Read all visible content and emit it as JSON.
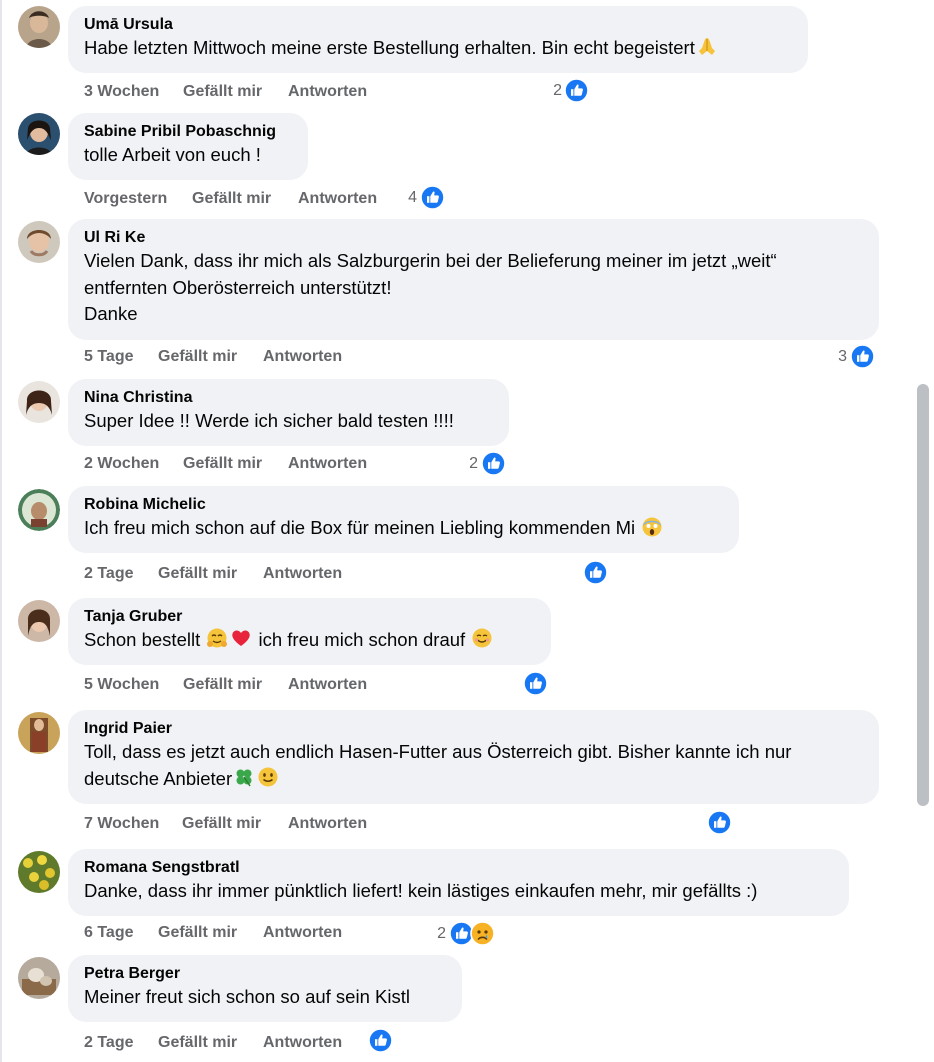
{
  "labels": {
    "like": "Gefällt mir",
    "reply": "Antworten"
  },
  "colors": {
    "like_blue": "#1877f2",
    "bubble": "#f0f2f5",
    "meta_grey": "#65676b",
    "heart": "#e8243c"
  },
  "comments": [
    {
      "author": "Umā Ursula",
      "text": "Habe letzten Mittwoch meine erste Bestellung erhalten. Bin echt begeistert",
      "emoji_after": [
        "folded-hands-emoji"
      ],
      "time": "3 Wochen",
      "reactions": "2",
      "reaction_icons": [
        "like-icon"
      ]
    },
    {
      "author": "Sabine Pribil Pobaschnig",
      "text": "tolle Arbeit von euch !",
      "time": "Vorgestern",
      "reactions": "4",
      "reaction_icons": [
        "like-icon"
      ]
    },
    {
      "author": "Ul Ri Ke",
      "text": "Vielen Dank, dass ihr mich als Salzburgerin bei der Belieferung meiner im jetzt „weit“ entfernten Oberösterreich unterstützt!\nDanke",
      "time": "5 Tage",
      "reactions": "3",
      "reaction_icons": [
        "like-icon"
      ]
    },
    {
      "author": "Nina Christina",
      "text": "Super Idee !! Werde ich sicher bald testen !!!!",
      "time": "2 Wochen",
      "reactions": "2",
      "reaction_icons": [
        "like-icon"
      ]
    },
    {
      "author": "Robina Michelic",
      "text": "Ich freu mich schon auf die Box für meinen Liebling kommenden Mi",
      "emoji_after": [
        "screaming-face-emoji"
      ],
      "time": "2 Tage",
      "reactions": "",
      "reaction_icons": [
        "like-icon"
      ]
    },
    {
      "author": "Tanja Gruber",
      "text_parts": [
        "Schon bestellt",
        "ich freu mich schon drauf"
      ],
      "emoji_mid": [
        "hugging-face-emoji",
        "red-heart-emoji"
      ],
      "emoji_after": [
        "smiling-face-emoji"
      ],
      "time": "5 Wochen",
      "reactions": "",
      "reaction_icons": [
        "like-icon"
      ]
    },
    {
      "author": "Ingrid Paier",
      "text": "Toll, dass es jetzt auch endlich Hasen-Futter aus Österreich gibt. Bisher kannte ich nur deutsche Anbieter",
      "emoji_after": [
        "four-leaf-clover-emoji",
        "slightly-smiling-face-emoji"
      ],
      "time": "7 Wochen",
      "reactions": "",
      "reaction_icons": [
        "like-icon"
      ]
    },
    {
      "author": "Romana Sengstbratl",
      "text": "Danke, dass ihr immer pünktlich liefert! kein lästiges einkaufen mehr, mir gefällts :)",
      "time": "6 Tage",
      "reactions": "2",
      "reaction_icons": [
        "like-icon",
        "sad-face-icon"
      ]
    },
    {
      "author": "Petra Berger",
      "text": "Meiner freut sich schon so auf sein Kistl",
      "time": "2 Tage",
      "reactions": "",
      "reaction_icons": [
        "like-icon"
      ]
    }
  ]
}
